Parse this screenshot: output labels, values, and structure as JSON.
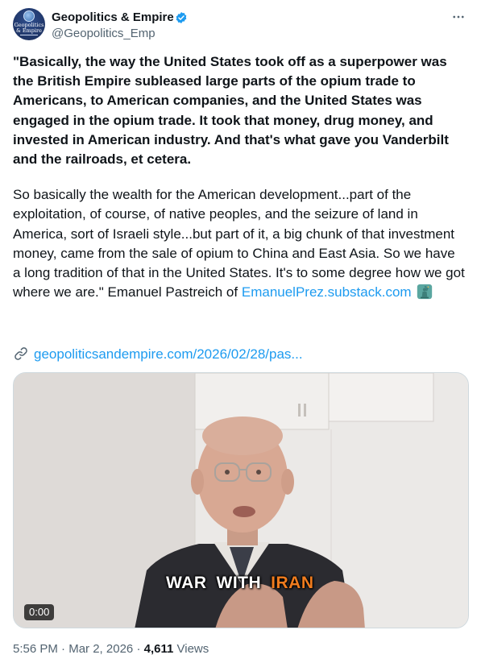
{
  "account": {
    "name": "Geopolitics & Empire",
    "handle": "@Geopolitics_Emp",
    "avatar_text_line1": "Geopolitics",
    "avatar_text_line2": "& Empire",
    "verified_color": "#1d9bf0"
  },
  "post": {
    "bold_quote": "\"Basically, the way the United States took off as a superpower was the British Empire subleased large parts of the opium trade to Americans, to American companies, and the United States was engaged in the opium trade. It took that money, drug money, and invested in American industry. And that's what gave you Vanderbilt and the railroads, et cetera.",
    "paragraph2": "So basically the wealth for the American development...part of the exploitation, of course, of native peoples, and the seizure of land in America, sort of Israeli style...but part of it, a big chunk of that investment money, came from the sale of opium to China and East Asia. So we have a long tradition of that in the United States. It's to some degree how we got where we are.\" Emanuel Pastreich of",
    "substack_link": "EmanuelPrez.substack.com",
    "emoji": "statue-of-liberty",
    "external_link": "geopoliticsandempire.com/2026/02/28/pas..."
  },
  "video": {
    "duration": "0:00",
    "caption_word1": "WAR",
    "caption_word2": "WITH",
    "caption_word3": "IRAN",
    "caption_highlight_color": "#f07c1e"
  },
  "meta": {
    "time": "5:56 PM",
    "separator": "·",
    "date": "Mar 2, 2026",
    "views_count": "4,611",
    "views_label": "Views"
  },
  "icons": {
    "more": "more-options-icon",
    "link": "link-icon",
    "verified": "verified-badge-icon"
  }
}
